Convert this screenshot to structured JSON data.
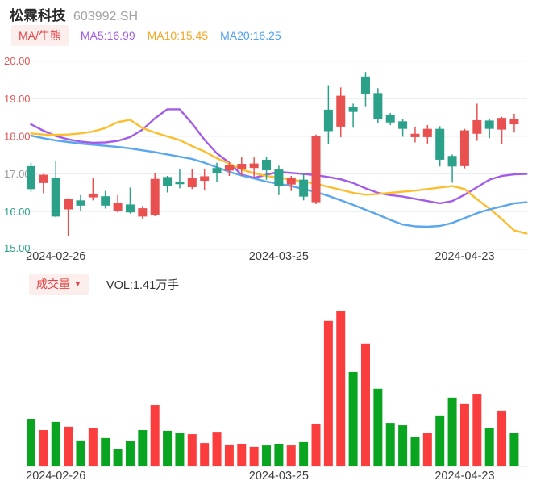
{
  "header": {
    "title": "松霖科技",
    "code": "603992.SH"
  },
  "price_pane": {
    "indicator_label": "MA/牛熊",
    "legend": [
      {
        "label": "MA5:16.99",
        "color": "#a35ce8"
      },
      {
        "label": "MA10:15.45",
        "color": "#f5a623"
      },
      {
        "label": "MA20:16.25",
        "color": "#4a9ff5"
      }
    ]
  },
  "volume_pane": {
    "selector_label": "成交量",
    "dropdown_icon": "▼",
    "vol_label": "VOL:1.41万手"
  },
  "colors": {
    "candle_up": "#e95050",
    "candle_down": "#2ba189",
    "vol_up": "#fb3d3d",
    "vol_down": "#0aa520",
    "grid": "#e8ecf2",
    "baseline": "#e2e2e2",
    "axis_red": "#e25555",
    "axis_green": "#2aa28a",
    "axis_gray": "#9a9a9a",
    "ma5": "#a35ce8",
    "ma10": "#fcbe2e",
    "ma20": "#5aa7f0"
  },
  "chart_data": {
    "type": "candlestick+volume",
    "title": "松霖科技 603992.SH daily",
    "y_axis": {
      "min": 15,
      "max": 20,
      "labels": [
        {
          "value": 20,
          "text": "20.00",
          "color_key": "axis_red"
        },
        {
          "value": 19,
          "text": "19.00",
          "color_key": "axis_red"
        },
        {
          "value": 18,
          "text": "18.00",
          "color_key": "axis_red"
        },
        {
          "value": 17,
          "text": "17.00",
          "color_key": "axis_gray"
        },
        {
          "value": 16,
          "text": "16.00",
          "color_key": "axis_green"
        },
        {
          "value": 15,
          "text": "15.00",
          "color_key": "axis_green"
        }
      ]
    },
    "x_tick_labels": [
      {
        "index": 2,
        "label": "2024-02-26"
      },
      {
        "index": 20,
        "label": "2024-03-25"
      },
      {
        "index": 35,
        "label": "2024-04-23"
      }
    ],
    "candles_format": [
      "open",
      "high",
      "low",
      "close"
    ],
    "candles": [
      [
        17.21,
        17.3,
        16.53,
        16.6
      ],
      [
        16.76,
        17.0,
        16.49,
        16.98
      ],
      [
        16.89,
        17.36,
        15.85,
        15.87
      ],
      [
        16.06,
        16.36,
        15.36,
        16.34
      ],
      [
        16.3,
        16.44,
        16.01,
        16.16
      ],
      [
        16.38,
        16.9,
        16.3,
        16.48
      ],
      [
        16.41,
        16.55,
        16.08,
        16.16
      ],
      [
        16.01,
        16.44,
        15.98,
        16.23
      ],
      [
        16.19,
        16.64,
        15.95,
        15.98
      ],
      [
        15.87,
        16.15,
        15.8,
        16.09
      ],
      [
        15.9,
        17.02,
        15.88,
        16.87
      ],
      [
        16.92,
        16.95,
        16.51,
        16.69
      ],
      [
        16.8,
        17.12,
        16.62,
        16.73
      ],
      [
        16.65,
        17.12,
        16.6,
        16.89
      ],
      [
        16.82,
        17.14,
        16.56,
        16.94
      ],
      [
        17.16,
        17.3,
        16.8,
        17.02
      ],
      [
        17.09,
        17.3,
        16.95,
        17.23
      ],
      [
        17.14,
        17.45,
        16.95,
        17.27
      ],
      [
        17.16,
        17.44,
        16.93,
        17.28
      ],
      [
        17.38,
        17.45,
        16.85,
        17.1
      ],
      [
        17.12,
        17.22,
        16.44,
        16.67
      ],
      [
        16.72,
        16.95,
        16.55,
        16.9
      ],
      [
        16.85,
        17.0,
        16.3,
        16.4
      ],
      [
        16.25,
        18.05,
        16.2,
        18.01
      ],
      [
        18.71,
        19.36,
        17.8,
        18.14
      ],
      [
        18.26,
        19.3,
        17.98,
        19.08
      ],
      [
        18.79,
        18.87,
        18.23,
        18.65
      ],
      [
        19.59,
        19.71,
        18.8,
        19.12
      ],
      [
        19.15,
        19.28,
        18.36,
        18.47
      ],
      [
        18.57,
        18.62,
        18.3,
        18.37
      ],
      [
        18.4,
        18.45,
        17.99,
        18.2
      ],
      [
        17.98,
        18.25,
        17.84,
        18.07
      ],
      [
        17.98,
        18.3,
        17.81,
        18.2
      ],
      [
        18.2,
        18.27,
        17.2,
        17.38
      ],
      [
        17.48,
        17.52,
        16.77,
        17.2
      ],
      [
        17.21,
        18.2,
        17.15,
        18.16
      ],
      [
        18.07,
        18.87,
        17.88,
        18.43
      ],
      [
        18.42,
        18.45,
        17.95,
        18.2
      ],
      [
        18.18,
        18.52,
        17.8,
        18.49
      ],
      [
        18.32,
        18.6,
        18.1,
        18.46
      ]
    ],
    "volume": {
      "unit": "万手",
      "latest_label": "VOL:1.41万手",
      "values": [
        1.98,
        1.51,
        1.85,
        1.65,
        1.08,
        1.58,
        1.18,
        0.71,
        1.04,
        1.51,
        2.55,
        1.48,
        1.38,
        1.34,
        0.97,
        1.44,
        0.91,
        0.94,
        0.81,
        0.87,
        0.94,
        0.87,
        1.01,
        1.78,
        6.05,
        6.45,
        3.93,
        5.11,
        3.23,
        1.81,
        1.71,
        1.21,
        1.38,
        2.12,
        2.86,
        2.59,
        3.02,
        1.61,
        2.32,
        1.41
      ],
      "directions": [
        "g",
        "r",
        "g",
        "r",
        "g",
        "r",
        "g",
        "g",
        "g",
        "g",
        "r",
        "g",
        "g",
        "r",
        "r",
        "r",
        "r",
        "r",
        "r",
        "g",
        "g",
        "r",
        "g",
        "r",
        "r",
        "r",
        "g",
        "r",
        "g",
        "g",
        "g",
        "g",
        "r",
        "g",
        "g",
        "r",
        "r",
        "g",
        "r",
        "g"
      ]
    },
    "series": [
      {
        "name": "MA5",
        "color_key": "ma5",
        "values": [
          18.32,
          18.15,
          18.01,
          17.92,
          17.86,
          17.83,
          17.84,
          17.88,
          17.98,
          18.18,
          18.48,
          18.72,
          18.72,
          18.34,
          17.91,
          17.55,
          17.3,
          16.98,
          16.9,
          16.98,
          17.06,
          17.03,
          17.0,
          16.97,
          16.92,
          16.86,
          16.76,
          16.62,
          16.5,
          16.44,
          16.4,
          16.34,
          16.28,
          16.22,
          16.28,
          16.45,
          16.65,
          16.85,
          16.95,
          16.99,
          17.0
        ]
      },
      {
        "name": "MA10",
        "color_key": "ma10",
        "values": [
          18.08,
          18.05,
          18.04,
          18.05,
          18.08,
          18.13,
          18.22,
          18.38,
          18.44,
          18.22,
          18.1,
          18.0,
          17.9,
          17.74,
          17.6,
          17.42,
          17.28,
          17.12,
          17.02,
          16.95,
          16.9,
          16.85,
          16.8,
          16.74,
          16.66,
          16.58,
          16.5,
          16.45,
          16.47,
          16.5,
          16.53,
          16.56,
          16.6,
          16.64,
          16.68,
          16.6,
          16.33,
          16.08,
          15.8,
          15.5,
          15.42
        ]
      },
      {
        "name": "MA20",
        "color_key": "ma20",
        "values": [
          18.02,
          17.95,
          17.89,
          17.85,
          17.81,
          17.78,
          17.75,
          17.72,
          17.68,
          17.63,
          17.58,
          17.52,
          17.46,
          17.4,
          17.3,
          17.18,
          17.06,
          16.96,
          16.88,
          16.8,
          16.74,
          16.68,
          16.6,
          16.52,
          16.42,
          16.3,
          16.18,
          16.05,
          15.92,
          15.78,
          15.66,
          15.61,
          15.6,
          15.62,
          15.7,
          15.83,
          15.96,
          16.06,
          16.14,
          16.22,
          16.25
        ]
      }
    ],
    "layout": {
      "grid": true,
      "legend_position": "top"
    }
  }
}
